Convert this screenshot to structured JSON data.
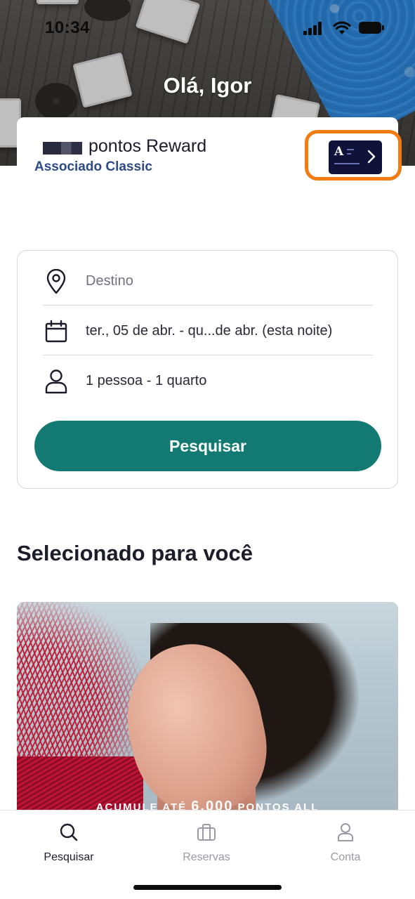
{
  "status_bar": {
    "time": "10:34"
  },
  "header": {
    "greeting": "Olá, Igor",
    "points_label": "pontos Reward",
    "tier": "Associado Classic",
    "card_logo": "A"
  },
  "search": {
    "destination_placeholder": "Destino",
    "dates": "ter., 05 de abr. - qu...de abr. (esta noite)",
    "guests": "1 pessoa - 1 quarto",
    "submit_label": "Pesquisar"
  },
  "featured": {
    "title": "Selecionado para você",
    "promo_prefix": "ACUMULE ATÉ",
    "promo_amount": "6.000",
    "promo_suffix": "PONTOS ALL"
  },
  "tabbar": {
    "items": [
      {
        "label": "Pesquisar",
        "icon": "search-icon",
        "active": true
      },
      {
        "label": "Reservas",
        "icon": "briefcase-icon",
        "active": false
      },
      {
        "label": "Conta",
        "icon": "person-icon",
        "active": false
      }
    ]
  },
  "colors": {
    "primary": "#127a72",
    "tier": "#2e4a88",
    "highlight": "#f47a12",
    "card": "#11123a"
  }
}
